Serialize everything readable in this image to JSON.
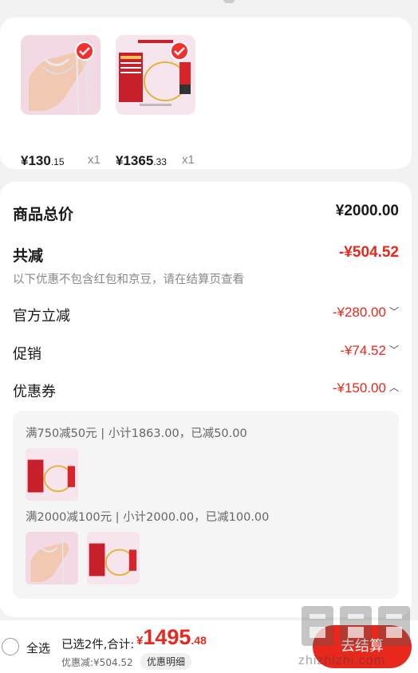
{
  "products": [
    {
      "price_int": "¥130",
      "price_dec": ".15",
      "qty": "x1",
      "image": "bracelet-on-hand"
    },
    {
      "price_int": "¥1365",
      "price_dec": ".33",
      "qty": "x1",
      "image": "gold-bracelet-box"
    }
  ],
  "summary": {
    "total_label": "商品总价",
    "total_value": "¥2000.00",
    "reduce_label": "共减",
    "reduce_value": "-¥504.52",
    "note": "以下优惠不包含红包和京豆，请在结算页查看",
    "items": [
      {
        "label": "官方立减",
        "value": "-¥280.00",
        "icon": "chevron-down-icon"
      },
      {
        "label": "促销",
        "value": "-¥74.52",
        "icon": "chevron-down-icon"
      },
      {
        "label": "优惠券",
        "value": "-¥150.00",
        "icon": "chevron-up-icon"
      }
    ],
    "coupons": [
      {
        "rule": "满750减50元 | 小计1863.00，已减50.00"
      },
      {
        "rule": "满2000减100元 | 小计2000.00，已减100.00"
      }
    ]
  },
  "bottom": {
    "select_all": "全选",
    "selected_text": "已选2件,合计:",
    "total_yen": "¥",
    "total_int": "1495",
    "total_dec": ".48",
    "discount_text": "优惠减:¥504.52",
    "detail_button": "优惠明细",
    "checkout_button": "去结算"
  },
  "watermark": {
    "text": "zhizhizhi.com"
  },
  "colors": {
    "accent": "#e8281c",
    "background": "#f2f2f2",
    "card": "#ffffff"
  }
}
